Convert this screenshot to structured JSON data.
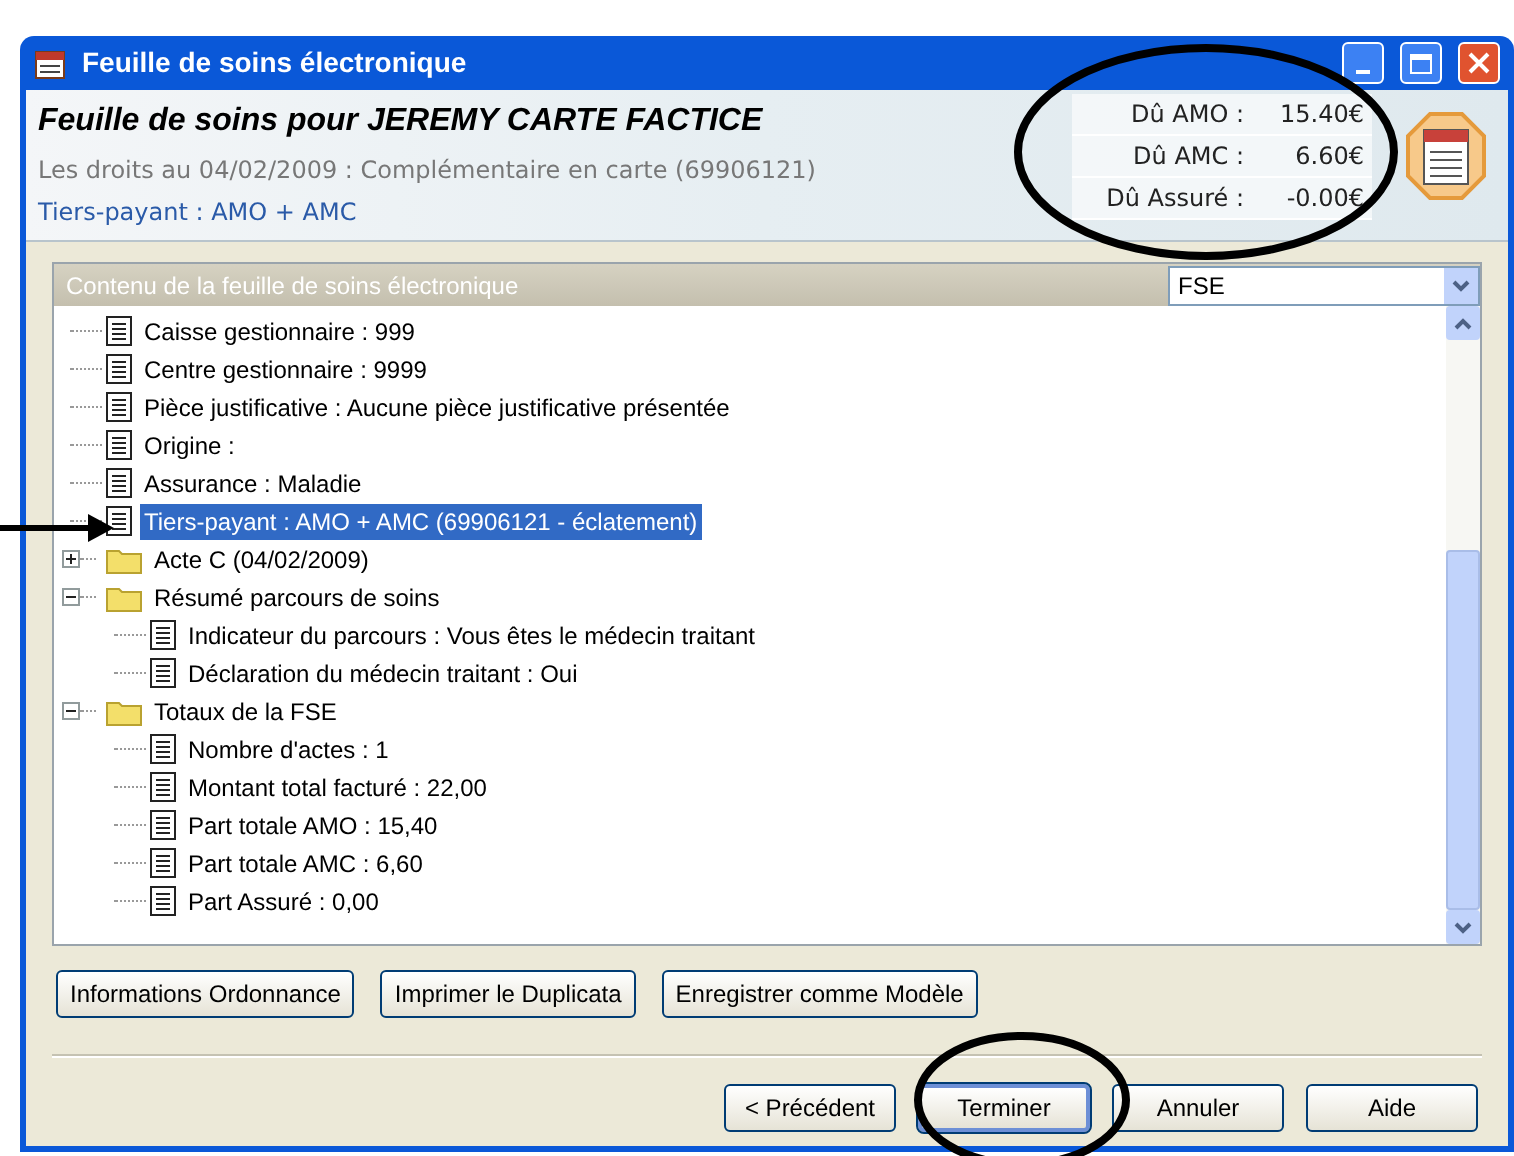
{
  "window": {
    "title": "Feuille de soins électronique"
  },
  "header": {
    "title": "Feuille de soins pour JEREMY CARTE FACTICE",
    "rights": "Les droits au 04/02/2009 : Complémentaire en carte (69906121)",
    "third_party": "Tiers-payant : AMO + AMC",
    "amounts": [
      {
        "label": "Dû AMO :",
        "value": "15.40€"
      },
      {
        "label": "Dû AMC :",
        "value": "6.60€"
      },
      {
        "label": "Dû Assuré :",
        "value": "-0.00€"
      }
    ]
  },
  "content": {
    "title": "Contenu de la feuille de soins électronique",
    "view_select": {
      "value": "FSE"
    },
    "tree": [
      {
        "kind": "document",
        "label": "Caisse gestionnaire : 999",
        "selected": false
      },
      {
        "kind": "document",
        "label": "Centre gestionnaire : 9999",
        "selected": false
      },
      {
        "kind": "document",
        "label": "Pièce justificative : Aucune pièce justificative présentée",
        "selected": false
      },
      {
        "kind": "document",
        "label": "Origine :",
        "selected": false
      },
      {
        "kind": "document",
        "label": "Assurance : Maladie",
        "selected": false
      },
      {
        "kind": "document",
        "label": "Tiers-payant : AMO + AMC (69906121 - éclatement)",
        "selected": true
      },
      {
        "kind": "folder",
        "label": "Acte C (04/02/2009)",
        "selected": false,
        "expanded": false
      },
      {
        "kind": "folder",
        "label": "Résumé parcours de soins",
        "selected": false,
        "expanded": true,
        "children": [
          {
            "kind": "document",
            "label": "Indicateur du parcours : Vous êtes le médecin traitant",
            "selected": false
          },
          {
            "kind": "document",
            "label": "Déclaration du médecin traitant : Oui",
            "selected": false
          }
        ]
      },
      {
        "kind": "folder",
        "label": "Totaux de la FSE",
        "selected": false,
        "expanded": true,
        "children": [
          {
            "kind": "document",
            "label": "Nombre d'actes : 1",
            "selected": false
          },
          {
            "kind": "document",
            "label": "Montant total facturé : 22,00",
            "selected": false
          },
          {
            "kind": "document",
            "label": "Part totale AMO : 15,40",
            "selected": false
          },
          {
            "kind": "document",
            "label": "Part totale AMC : 6,60",
            "selected": false
          },
          {
            "kind": "document",
            "label": "Part Assuré : 0,00",
            "selected": false
          }
        ]
      }
    ]
  },
  "actions": [
    "Informations Ordonnance",
    "Imprimer le Duplicata",
    "Enregistrer comme Modèle"
  ],
  "nav_buttons": [
    {
      "label": "< Précédent",
      "default": false
    },
    {
      "label": "Terminer",
      "default": true
    },
    {
      "label": "Annuler",
      "default": false
    },
    {
      "label": "Aide",
      "default": false
    }
  ]
}
